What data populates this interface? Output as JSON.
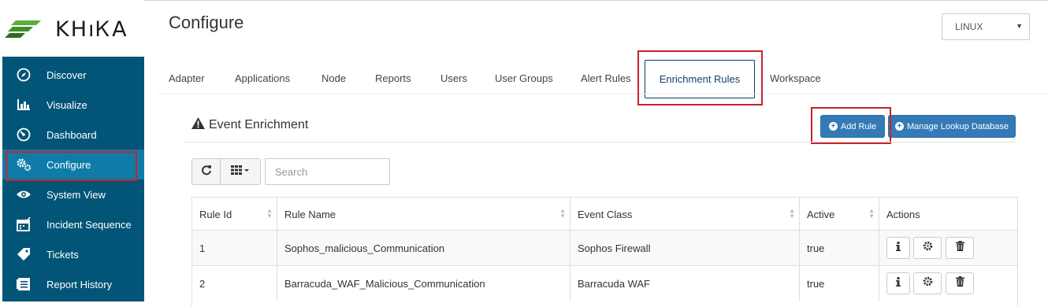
{
  "brand": {
    "name": "KHIKA",
    "logo_text": "KHıᏦA"
  },
  "sidebar": {
    "items": [
      {
        "label": "Discover",
        "icon": "compass-icon"
      },
      {
        "label": "Visualize",
        "icon": "bar-chart-icon"
      },
      {
        "label": "Dashboard",
        "icon": "dashboard-gauge-icon"
      },
      {
        "label": "Configure",
        "icon": "gears-icon",
        "active": true
      },
      {
        "label": "System View",
        "icon": "eye-icon"
      },
      {
        "label": "Incident Sequence",
        "icon": "calendar-check-icon"
      },
      {
        "label": "Tickets",
        "icon": "tag-icon"
      },
      {
        "label": "Report History",
        "icon": "book-list-icon"
      }
    ],
    "active_color": "#0f7ca7",
    "background": "#035578"
  },
  "header": {
    "title": "Configure",
    "platform_select": {
      "value": "LINUX"
    }
  },
  "tabs": [
    "Adapter",
    "Applications",
    "Node",
    "Reports",
    "Users",
    "User Groups",
    "Alert Rules",
    "Enrichment Rules",
    "Workspace"
  ],
  "active_tab": "Enrichment Rules",
  "panel": {
    "title": "Event Enrichment",
    "add_rule_label": "Add Rule",
    "manage_lookup_label": "Manage Lookup Database",
    "search_placeholder": "Search"
  },
  "table": {
    "columns": [
      "Rule Id",
      "Rule Name",
      "Event Class",
      "Active",
      "Actions"
    ],
    "rows": [
      {
        "id": "1",
        "name": "Sophos_malicious_Communication",
        "event_class": "Sophos Firewall",
        "active": "true"
      },
      {
        "id": "2",
        "name": "Barracuda_WAF_Malicious_Communication",
        "event_class": "Barracuda WAF",
        "active": "true"
      }
    ],
    "row_actions": [
      "info-icon",
      "gear-icon",
      "trash-icon"
    ]
  },
  "highlight_color": "#c9212e",
  "primary_button_color": "#337ab7"
}
